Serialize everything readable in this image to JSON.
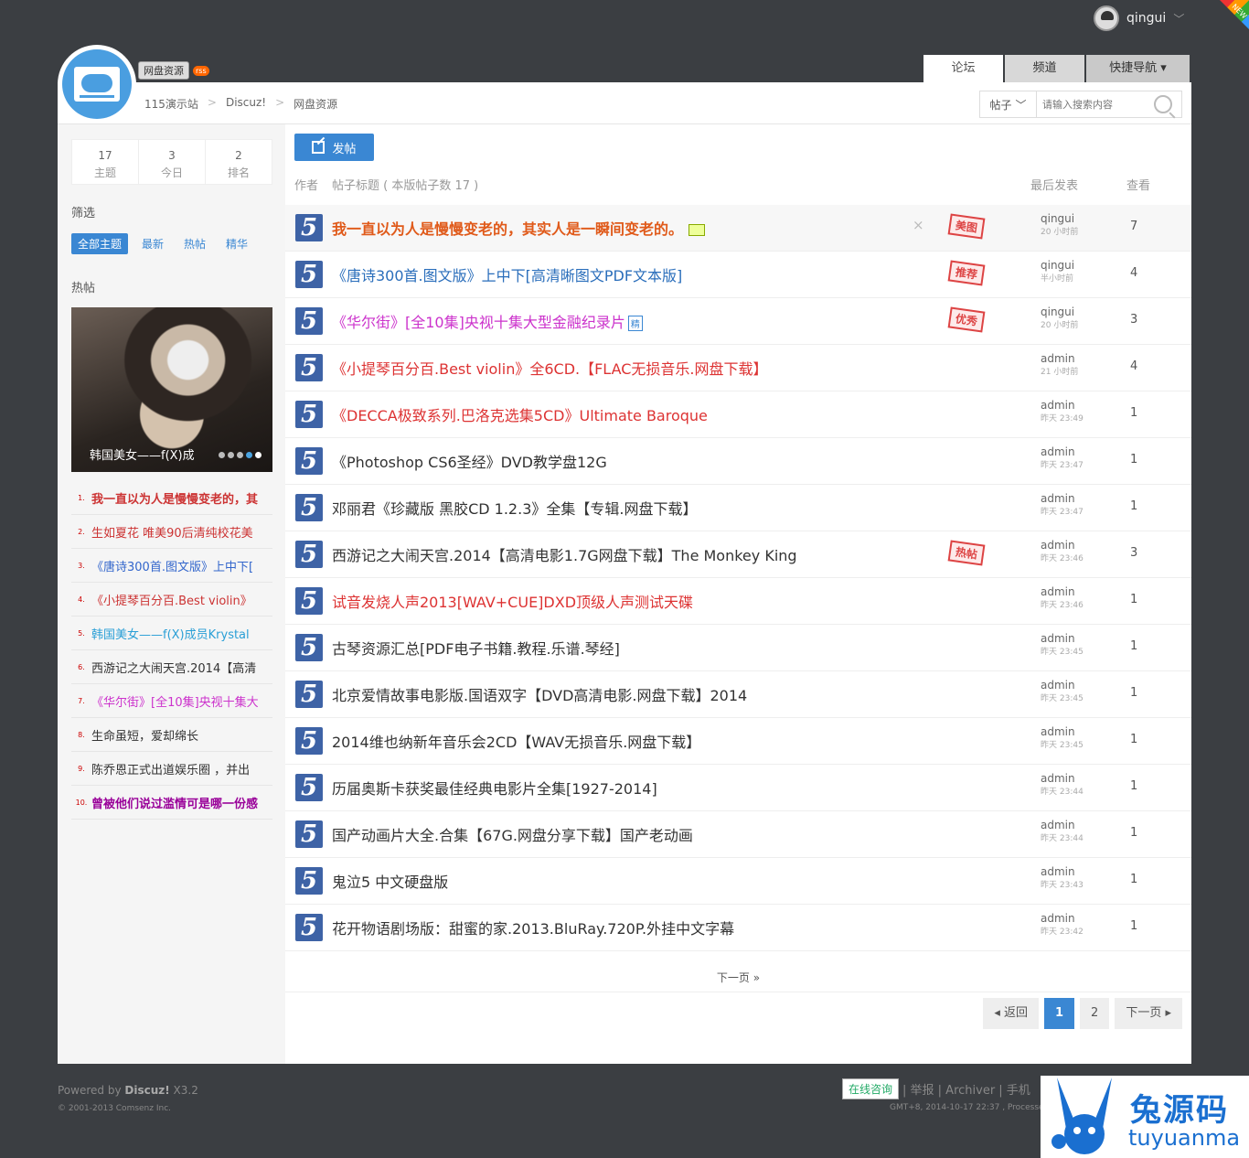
{
  "top_bar": {
    "username": "qingui",
    "new_label": "NEW"
  },
  "board": {
    "name": "网盘资源",
    "rss": "rss"
  },
  "nav_tabs": [
    {
      "label": "论坛"
    },
    {
      "label": "频道"
    },
    {
      "label": "快捷导航 ▾"
    }
  ],
  "breadcrumb": [
    "115演示站",
    "Discuz!",
    "网盘资源"
  ],
  "search": {
    "type": "帖子",
    "placeholder": "请输入搜索内容"
  },
  "stats": [
    {
      "value": "17",
      "label": "主题"
    },
    {
      "value": "3",
      "label": "今日"
    },
    {
      "value": "2",
      "label": "排名"
    }
  ],
  "sidebar": {
    "filter_heading": "筛选",
    "filters": [
      "全部主题",
      "最新",
      "热帖",
      "精华"
    ],
    "hot_heading": "热帖",
    "slide_caption": "韩国美女——f(X)成",
    "hot_list": [
      {
        "n": "1.",
        "title": "我一直以为人是慢慢变老的，其",
        "color": "#c33",
        "bold": true
      },
      {
        "n": "2.",
        "title": "生如夏花 唯美90后清纯校花美",
        "color": "#c33",
        "bold": false
      },
      {
        "n": "3.",
        "title": "《唐诗300首.图文版》上中下[",
        "color": "#36c",
        "bold": false
      },
      {
        "n": "4.",
        "title": "《小提琴百分百.Best violin》",
        "color": "#c33",
        "bold": false
      },
      {
        "n": "5.",
        "title": "韩国美女——f(X)成员Krystal",
        "color": "#2a9fd6",
        "bold": false
      },
      {
        "n": "6.",
        "title": "西游记之大闹天宫.2014【高清",
        "color": "#333",
        "bold": false
      },
      {
        "n": "7.",
        "title": "《华尔街》[全10集]央视十集大",
        "color": "#c3c",
        "bold": false
      },
      {
        "n": "8.",
        "title": "生命虽短，爱却绵长",
        "color": "#333",
        "bold": false
      },
      {
        "n": "9.",
        "title": "陈乔恩正式出道娱乐圈 ，并出",
        "color": "#333",
        "bold": false
      },
      {
        "n": "10.",
        "title": "曾被他们说过滥情可是哪一份感",
        "color": "#909",
        "bold": true
      }
    ]
  },
  "content": {
    "post_button": "发帖",
    "header": {
      "author": "作者",
      "title": "帖子标题 ( 本版帖子数 17 )",
      "last": "最后发表",
      "views": "查看"
    },
    "icon_glyph": "5",
    "threads": [
      {
        "title": "我一直以为人是慢慢变老的，其实人是一瞬间变老的。",
        "color": "#e05a1a",
        "bold": true,
        "img": true,
        "close": "×",
        "stamp": "美图",
        "author": "qingui",
        "when": "20 小时前",
        "views": "7"
      },
      {
        "title": "《唐诗300首.图文版》上中下[高清晰图文PDF文本版]",
        "color": "#2a6ebb",
        "stamp": "推荐",
        "author": "qingui",
        "when": "半小时前",
        "views": "4"
      },
      {
        "title": "《华尔街》[全10集]央视十集大型金融纪录片",
        "color": "#c3c",
        "jing": "精",
        "stamp": "优秀",
        "author": "qingui",
        "when": "20 小时前",
        "views": "3"
      },
      {
        "title": "《小提琴百分百.Best violin》全6CD.【FLAC无损音乐.网盘下载】",
        "color": "#d33",
        "author": "admin",
        "when": "21 小时前",
        "views": "4"
      },
      {
        "title": "《DECCA极致系列.巴洛克选集5CD》Ultimate Baroque",
        "color": "#d33",
        "author": "admin",
        "when": "昨天 23:49",
        "views": "1"
      },
      {
        "title": "《Photoshop CS6圣经》DVD教学盘12G",
        "color": "#333",
        "author": "admin",
        "when": "昨天 23:47",
        "views": "1"
      },
      {
        "title": "邓丽君《珍藏版 黑胶CD 1.2.3》全集【专辑.网盘下载】",
        "color": "#333",
        "author": "admin",
        "when": "昨天 23:47",
        "views": "1"
      },
      {
        "title": "西游记之大闹天宫.2014【高清电影1.7G网盘下载】The Monkey King",
        "color": "#333",
        "stamp": "热帖",
        "author": "admin",
        "when": "昨天 23:46",
        "views": "3"
      },
      {
        "title": "试音发烧人声2013[WAV+CUE]DXD顶级人声测试天碟",
        "color": "#d33",
        "author": "admin",
        "when": "昨天 23:46",
        "views": "1"
      },
      {
        "title": "古琴资源汇总[PDF电子书籍.教程.乐谱.琴经]",
        "color": "#333",
        "author": "admin",
        "when": "昨天 23:45",
        "views": "1"
      },
      {
        "title": "北京爱情故事电影版.国语双字【DVD高清电影.网盘下载】2014",
        "color": "#333",
        "author": "admin",
        "when": "昨天 23:45",
        "views": "1"
      },
      {
        "title": "2014维也纳新年音乐会2CD【WAV无损音乐.网盘下载】",
        "color": "#333",
        "author": "admin",
        "when": "昨天 23:45",
        "views": "1"
      },
      {
        "title": "历届奥斯卡获奖最佳经典电影片全集[1927-2014]",
        "color": "#333",
        "author": "admin",
        "when": "昨天 23:44",
        "views": "1"
      },
      {
        "title": "国产动画片大全.合集【67G.网盘分享下载】国产老动画",
        "color": "#333",
        "author": "admin",
        "when": "昨天 23:44",
        "views": "1"
      },
      {
        "title": "鬼泣5 中文硬盘版",
        "color": "#333",
        "author": "admin",
        "when": "昨天 23:43",
        "views": "1"
      },
      {
        "title": "花开物语剧场版：甜蜜的家.2013.BluRay.720P.外挂中文字幕",
        "color": "#333",
        "author": "admin",
        "when": "昨天 23:42",
        "views": "1"
      }
    ],
    "next_link": "下一页 »",
    "pager": {
      "back": "◂ 返回",
      "pages": [
        "1",
        "2"
      ],
      "next": "下一页 ▸"
    }
  },
  "footer": {
    "powered": "Powered by ",
    "brand": "Discuz!",
    "version": " X3.2",
    "copyright": "© 2001-2013 Comsenz Inc.",
    "online": "在线咨询",
    "links": "| 举报 | Archiver | 手机",
    "time": "GMT+8, 2014-10-17 22:37 , Processe"
  },
  "watermark": {
    "cn": "兔源码",
    "en": "tuyuanma"
  }
}
